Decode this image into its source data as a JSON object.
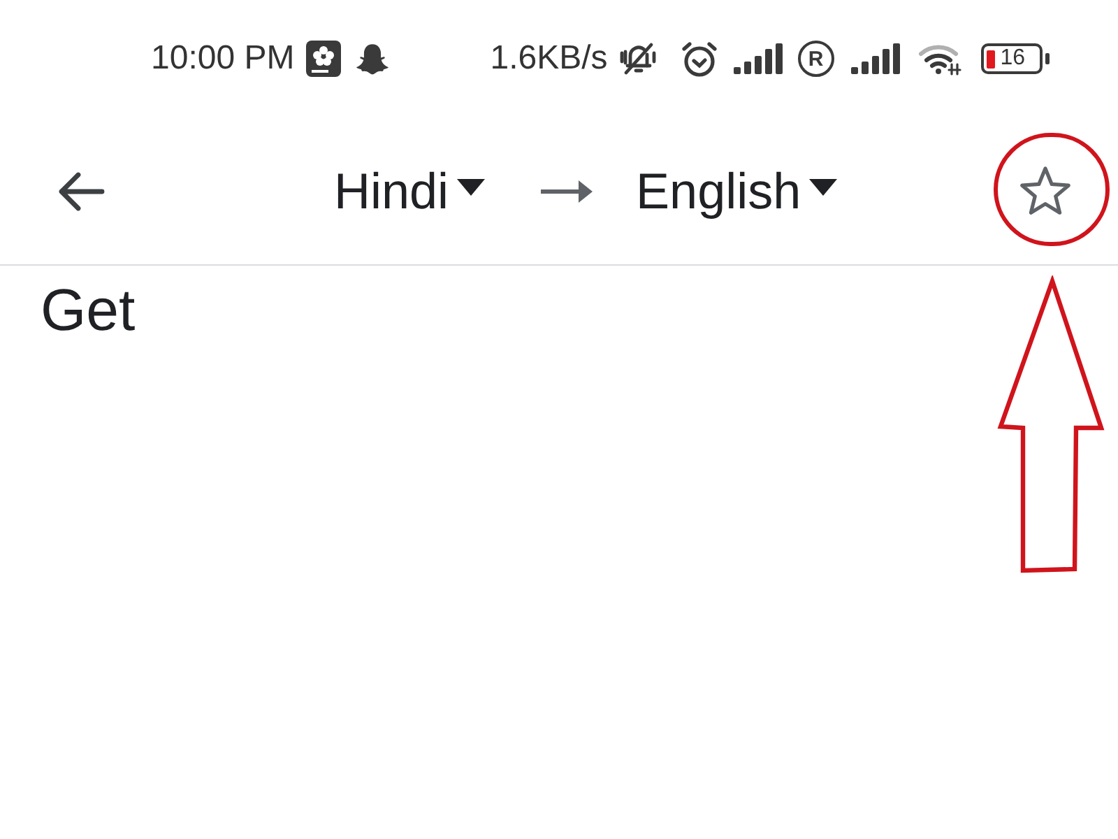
{
  "status_bar": {
    "time": "10:00 PM",
    "network_speed": "1.6KB/s",
    "roaming_indicator": "R",
    "battery_percent": "16"
  },
  "toolbar": {
    "source_language": "Hindi",
    "target_language": "English",
    "starred": false
  },
  "input": {
    "value": "Get"
  }
}
